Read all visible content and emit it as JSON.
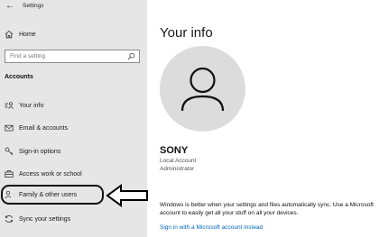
{
  "window": {
    "title": "Settings"
  },
  "sidebar": {
    "home_label": "Home",
    "search_placeholder": "Find a setting",
    "section_heading": "Accounts",
    "items": [
      {
        "label": "Your info",
        "icon": "person-list-icon"
      },
      {
        "label": "Email & accounts",
        "icon": "mail-icon"
      },
      {
        "label": "Sign-in options",
        "icon": "key-icon"
      },
      {
        "label": "Access work or school",
        "icon": "briefcase-icon"
      },
      {
        "label": "Family & other users",
        "icon": "person-add-icon"
      },
      {
        "label": "Sync your settings",
        "icon": "sync-icon"
      }
    ],
    "highlighted_item": "Family & other users"
  },
  "main": {
    "title": "Your info",
    "user": {
      "name": "SONY",
      "account_type": "Local Account",
      "role": "Administrator"
    },
    "sync_message": "Windows is better when your settings and files automatically sync. Use a Microsoft account to easily get all your stuff on all your devices.",
    "ms_link": "Sign in with a Microsoft account instead"
  },
  "colors": {
    "sidebar_bg": "#e6e6e6",
    "link": "#0067b8",
    "avatar_bg": "#dcdcdc"
  }
}
